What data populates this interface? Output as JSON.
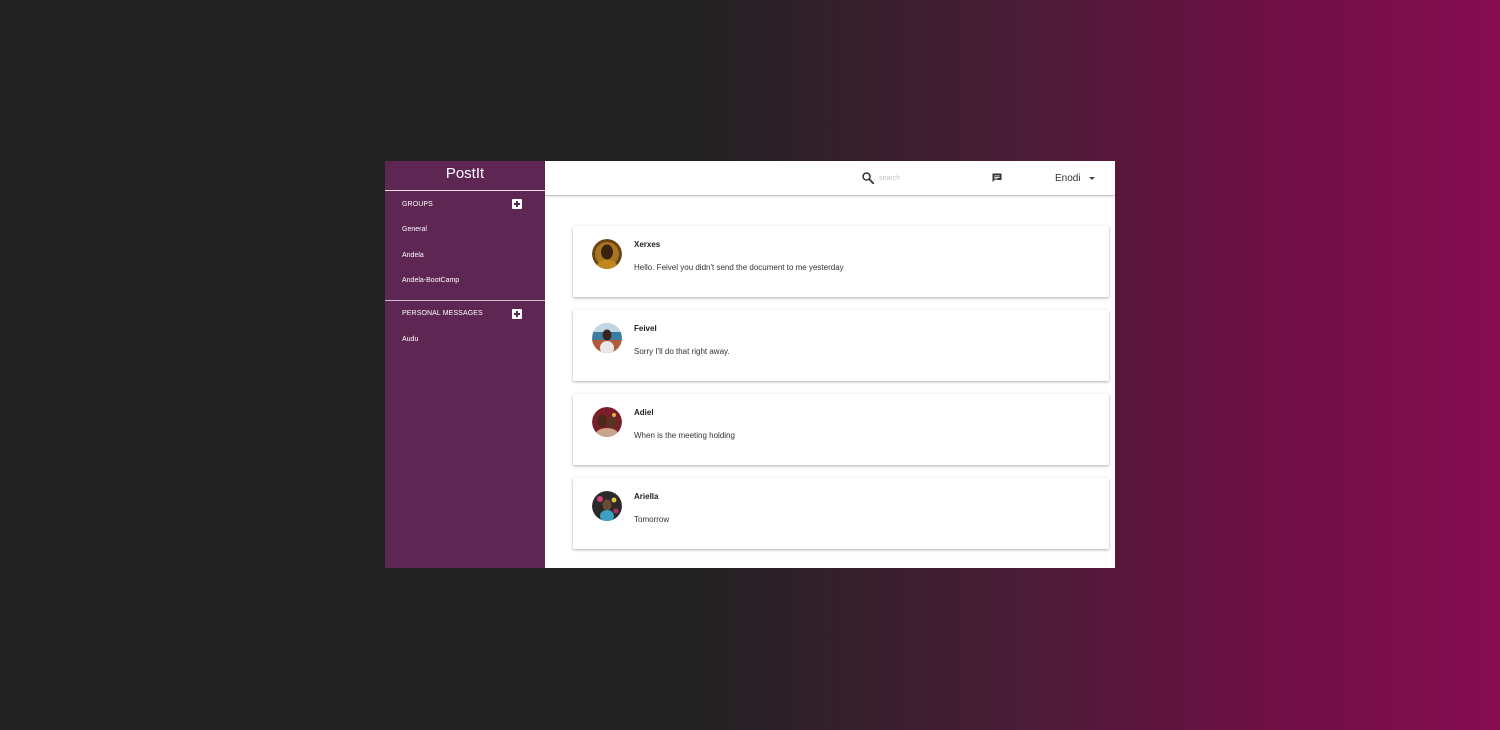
{
  "app": {
    "brand": "PostIt"
  },
  "sidebar": {
    "groups": {
      "title": "GROUPS",
      "items": [
        {
          "label": "General"
        },
        {
          "label": "Andela"
        },
        {
          "label": "Andela-BootCamp"
        }
      ]
    },
    "personal": {
      "title": "PERSONAL MESSAGES",
      "items": [
        {
          "label": "Audu"
        }
      ]
    }
  },
  "topbar": {
    "search_placeholder": "search",
    "search_value": "",
    "user_name": "Enodi",
    "icons": [
      "search-icon",
      "chat-icon",
      "caret-down-icon"
    ]
  },
  "messages": [
    {
      "sender": "Xerxes",
      "text": "Hello. Feivel you didn't send the document to me yesterday"
    },
    {
      "sender": "Feivel",
      "text": "Sorry I'll do that right away."
    },
    {
      "sender": "Adiel",
      "text": "When is the meeting holding"
    },
    {
      "sender": "Ariella",
      "text": "Tomorrow"
    }
  ],
  "colors": {
    "sidebar": "#5d2653",
    "background_left": "#222222",
    "background_right": "#860c50",
    "card": "#ffffff"
  }
}
